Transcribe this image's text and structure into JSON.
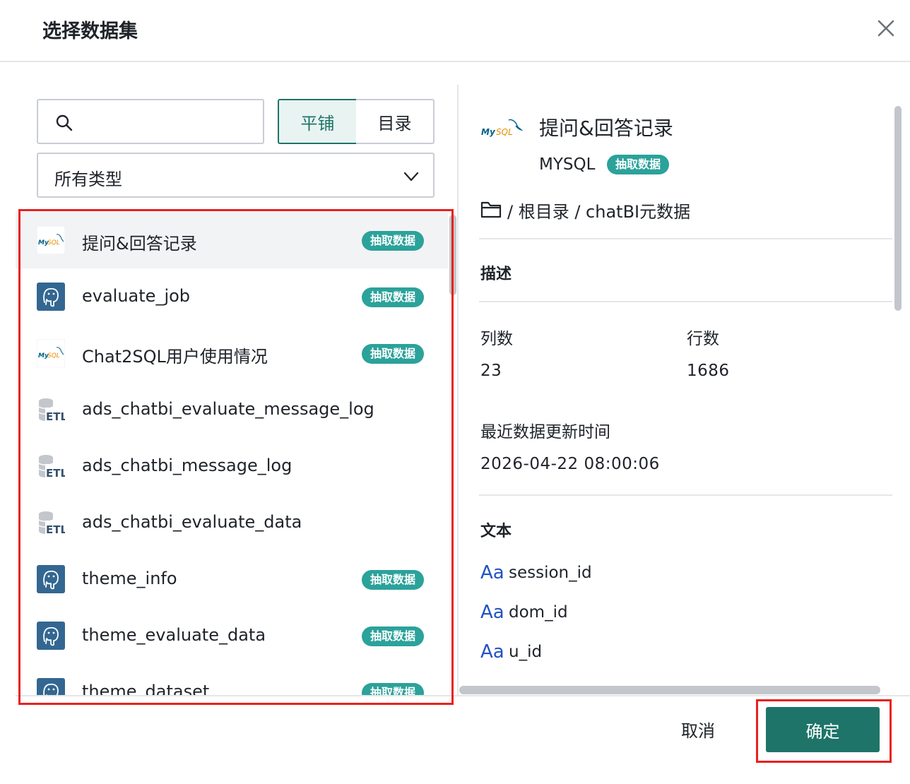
{
  "dialog": {
    "title": "选择数据集",
    "close_icon": "close-icon"
  },
  "left": {
    "search": {
      "value": "",
      "placeholder": "",
      "icon": "search-icon"
    },
    "view_toggle": {
      "tile_label": "平铺",
      "directory_label": "目录",
      "selected": "平铺"
    },
    "type_filter": {
      "value": "所有类型",
      "icon": "chevron-down-icon"
    },
    "datasets": [
      {
        "name": "提问&回答记录",
        "icon": "mysql-icon",
        "badge": "抽取数据",
        "selected": true
      },
      {
        "name": "evaluate_job",
        "icon": "postgresql-icon",
        "badge": "抽取数据"
      },
      {
        "name": "Chat2SQL用户使用情况",
        "icon": "mysql-icon",
        "badge": "抽取数据"
      },
      {
        "name": "ads_chatbi_evaluate_message_log",
        "icon": "etl-icon",
        "badge": ""
      },
      {
        "name": "ads_chatbi_message_log",
        "icon": "etl-icon",
        "badge": ""
      },
      {
        "name": "ads_chatbi_evaluate_data",
        "icon": "etl-icon",
        "badge": ""
      },
      {
        "name": "theme_info",
        "icon": "postgresql-icon",
        "badge": "抽取数据"
      },
      {
        "name": "theme_evaluate_data",
        "icon": "postgresql-icon",
        "badge": "抽取数据"
      },
      {
        "name": "theme_dataset",
        "icon": "postgresql-icon",
        "badge": "抽取数据"
      }
    ]
  },
  "detail": {
    "title": "提问&回答记录",
    "icon": "mysql-icon",
    "source_type": "MYSQL",
    "badge": "抽取数据",
    "path": "/ 根目录 / chatBI元数据",
    "description_title": "描述",
    "columns_label": "列数",
    "columns_value": "23",
    "rows_label": "行数",
    "rows_value": "1686",
    "updated_label": "最近数据更新时间",
    "updated_value": "2026-04-22 08:00:06",
    "text_section_title": "文本",
    "field_type_label": "Aa",
    "fields": [
      "session_id",
      "dom_id",
      "u_id"
    ]
  },
  "footer": {
    "cancel_label": "取消",
    "confirm_label": "确定"
  },
  "colors": {
    "accent": "#1e7468",
    "badge": "#2ba29a",
    "highlight_frame": "#e8211e",
    "field_type": "#2052c4"
  }
}
